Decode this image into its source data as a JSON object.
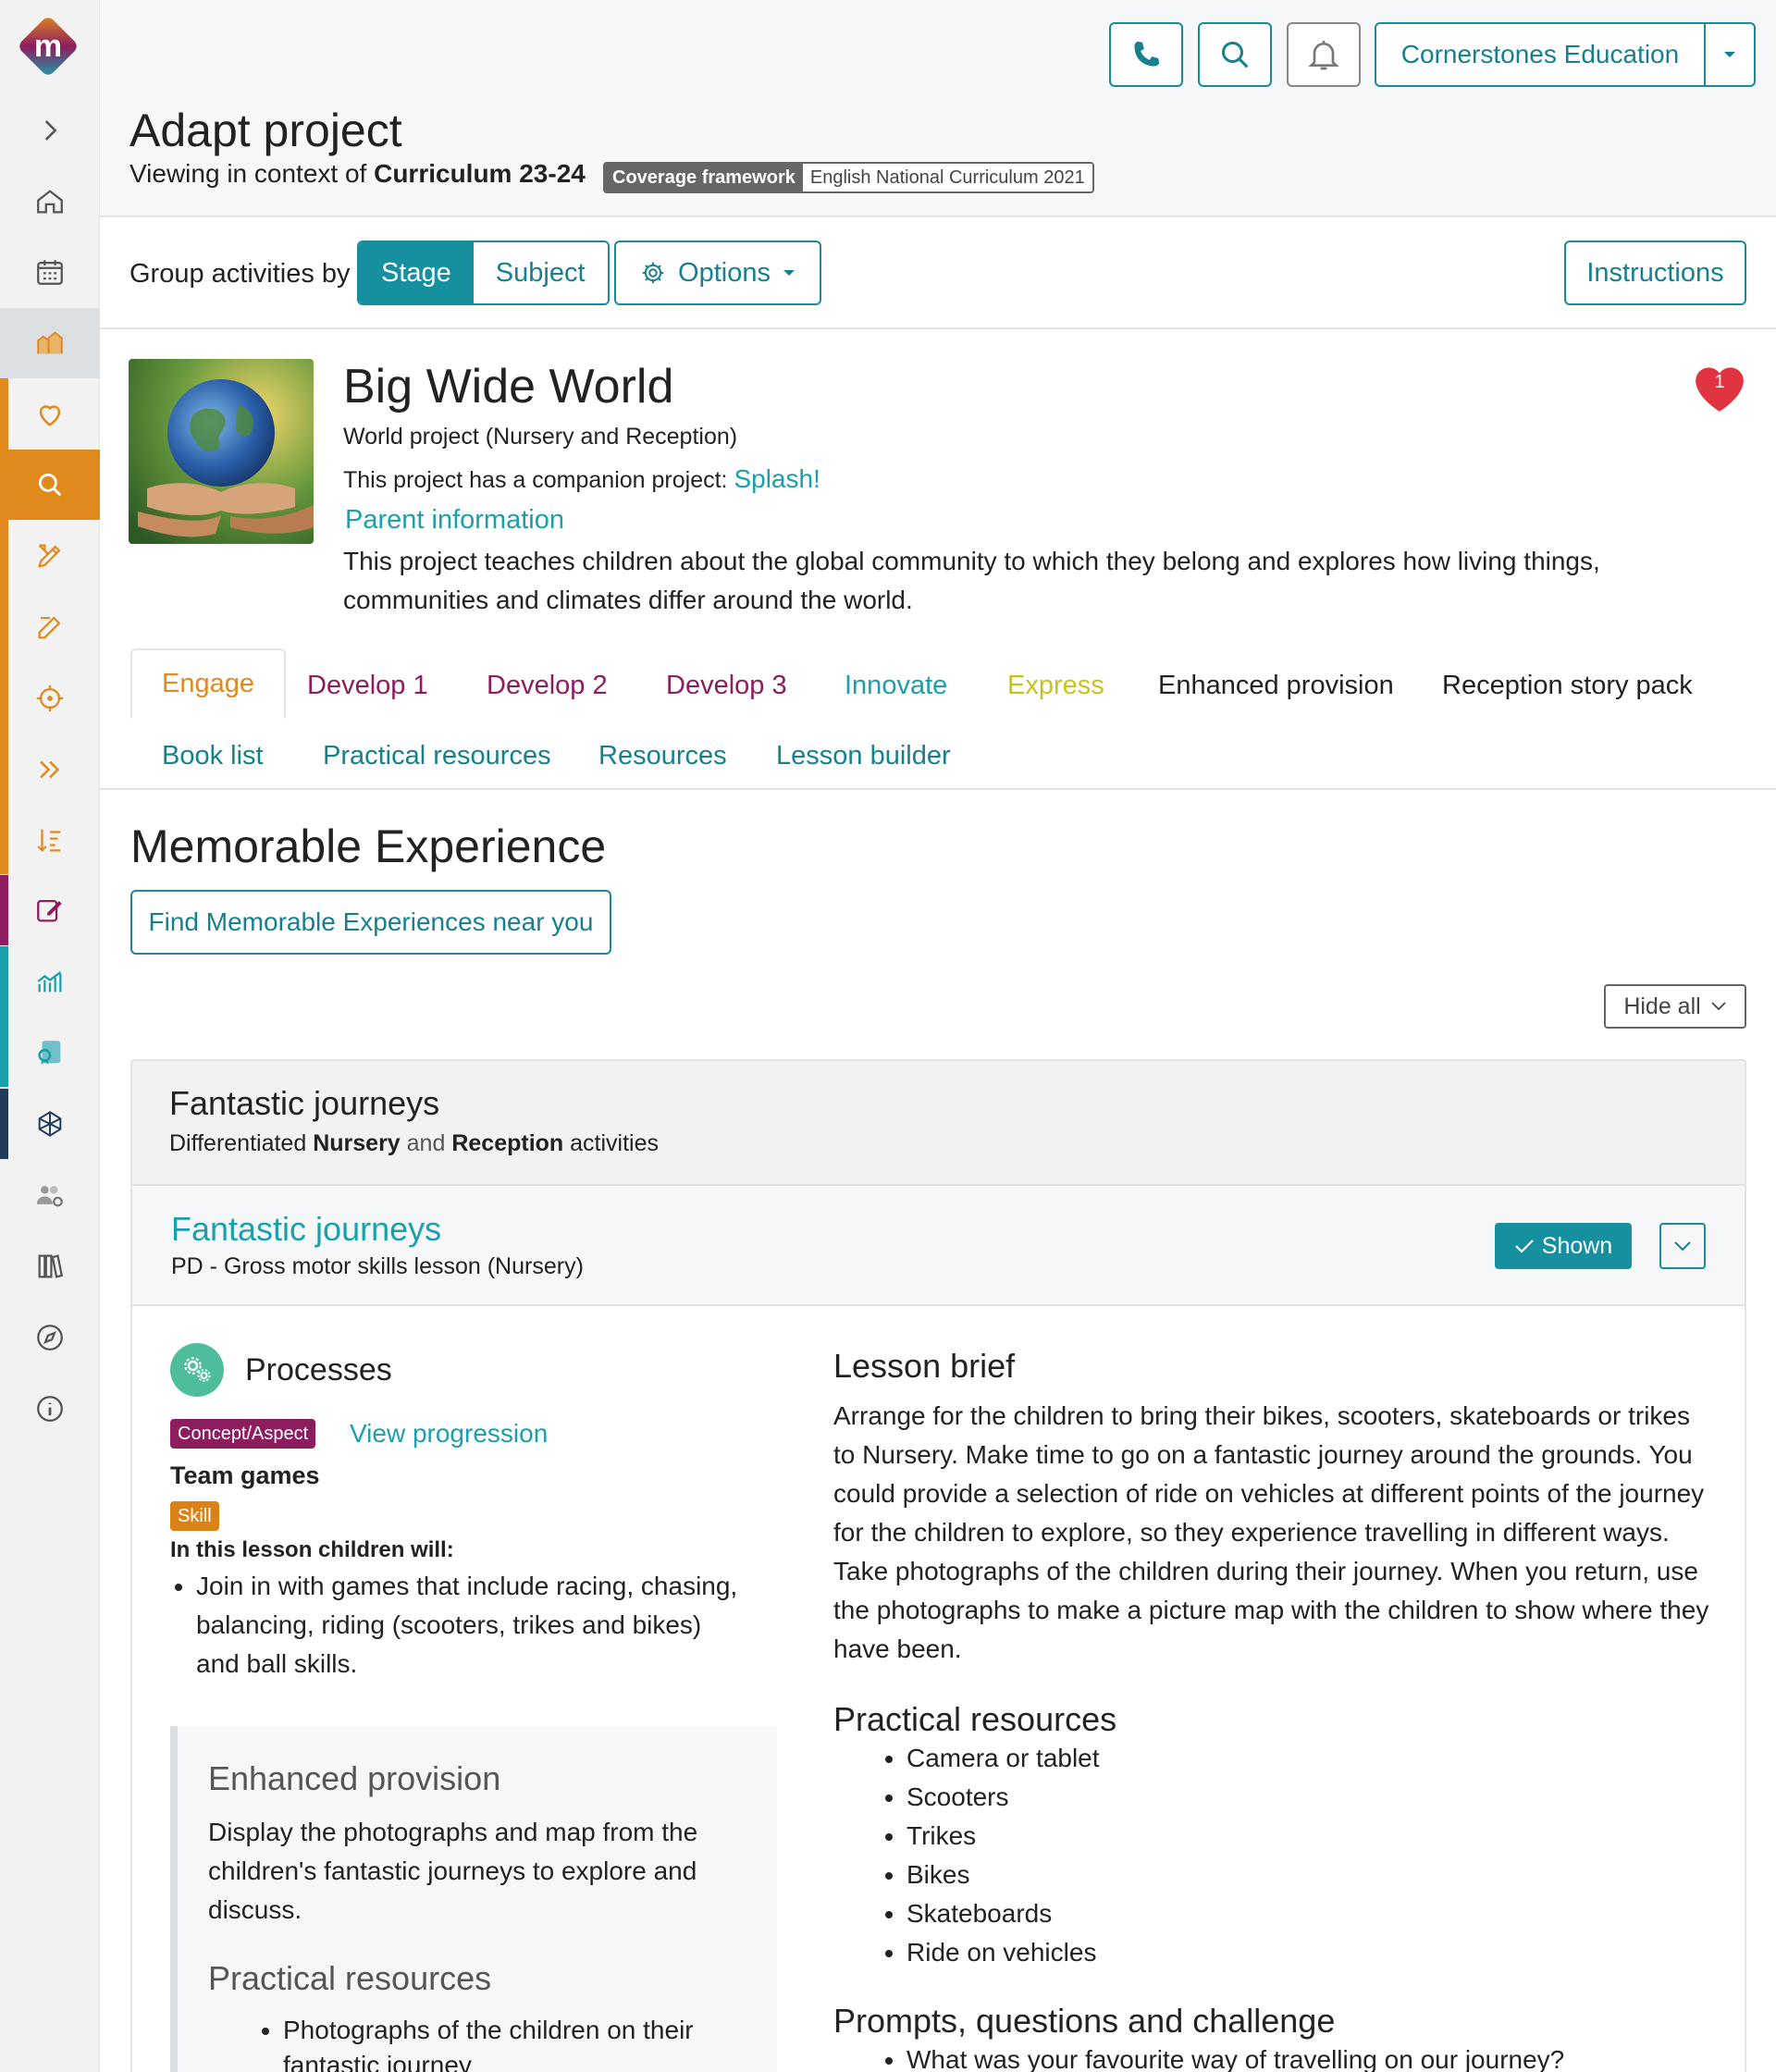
{
  "colors": {
    "accent": "#16909e",
    "link": "#1a9fac",
    "engage": "#e08a1e",
    "develop": "#8c1d5f",
    "innovate": "#1a9fac",
    "express": "#c9c21a",
    "concept_badge": "#8c1d5f",
    "skill_badge": "#d98218",
    "heart": "#e03540"
  },
  "header": {
    "icons": [
      "phone-icon",
      "search-icon",
      "bell-icon"
    ],
    "org": "Cornerstones Education",
    "title": "Adapt project",
    "context_prefix": "Viewing in context of",
    "context_value": "Curriculum 23-24",
    "coverage_key": "Coverage framework",
    "coverage_value": "English National Curriculum 2021"
  },
  "toolbar": {
    "group_label": "Group activities by",
    "stage": "Stage",
    "subject": "Subject",
    "options": "Options",
    "instructions": "Instructions"
  },
  "project": {
    "title": "Big Wide World",
    "subtitle": "World project (Nursery and Reception)",
    "companion_prefix": "This project has a companion project:",
    "companion_link": "Splash!",
    "parent_info": "Parent information",
    "description": "This project teaches children about the global community to which they belong and explores how living things, communities and climates differ around the world.",
    "favourites": "1"
  },
  "tabs": {
    "engage": "Engage",
    "develop1": "Develop 1",
    "develop2": "Develop 2",
    "develop3": "Develop 3",
    "innovate": "Innovate",
    "express": "Express",
    "enhanced": "Enhanced provision",
    "story": "Reception story pack",
    "booklist": "Book list",
    "practical": "Practical resources",
    "resources": "Resources",
    "builder": "Lesson builder"
  },
  "memorable": {
    "title": "Memorable Experience",
    "find": "Find Memorable Experiences near you",
    "hide_all": "Hide all"
  },
  "card": {
    "title": "Fantastic journeys",
    "sub_prefix": "Differentiated",
    "sub_nursery": "Nursery",
    "sub_and": "and",
    "sub_reception": "Reception",
    "sub_suffix": "activities",
    "inner_title": "Fantastic journeys",
    "inner_sub": "PD - Gross motor skills lesson (Nursery)",
    "shown": "Shown"
  },
  "lesson": {
    "processes": "Processes",
    "concept_badge": "Concept/Aspect",
    "view_progression": "View progression",
    "team_games": "Team games",
    "skill_badge": "Skill",
    "children_will": "In this lesson children will:",
    "will_items": [
      "Join in with games that include racing, chasing, balancing, riding (scooters, trikes and bikes) and ball skills."
    ],
    "enhanced_title": "Enhanced provision",
    "enhanced_text": "Display the photographs and map from the children's fantastic journeys to explore and discuss.",
    "enhanced_pr_title": "Practical resources",
    "enhanced_pr_items": [
      "Photographs of the children on their fantastic journey"
    ],
    "brief_title": "Lesson brief",
    "brief_text": "Arrange for the children to bring their bikes, scooters, skateboards or trikes to Nursery. Make time to go on a fantastic journey around the grounds. You could provide a selection of ride on vehicles at different points of the journey for the children to explore, so they experience travelling in different ways. Take photographs of the children during their journey. When you return, use the photographs to make a picture map with the children to show where they have been.",
    "pr_title": "Practical resources",
    "pr_items": [
      "Camera or tablet",
      "Scooters",
      "Trikes",
      "Bikes",
      "Skateboards",
      "Ride on vehicles"
    ],
    "prompts_title": "Prompts, questions and challenge",
    "prompts_items": [
      "What was your favourite way of travelling on our journey?"
    ]
  }
}
